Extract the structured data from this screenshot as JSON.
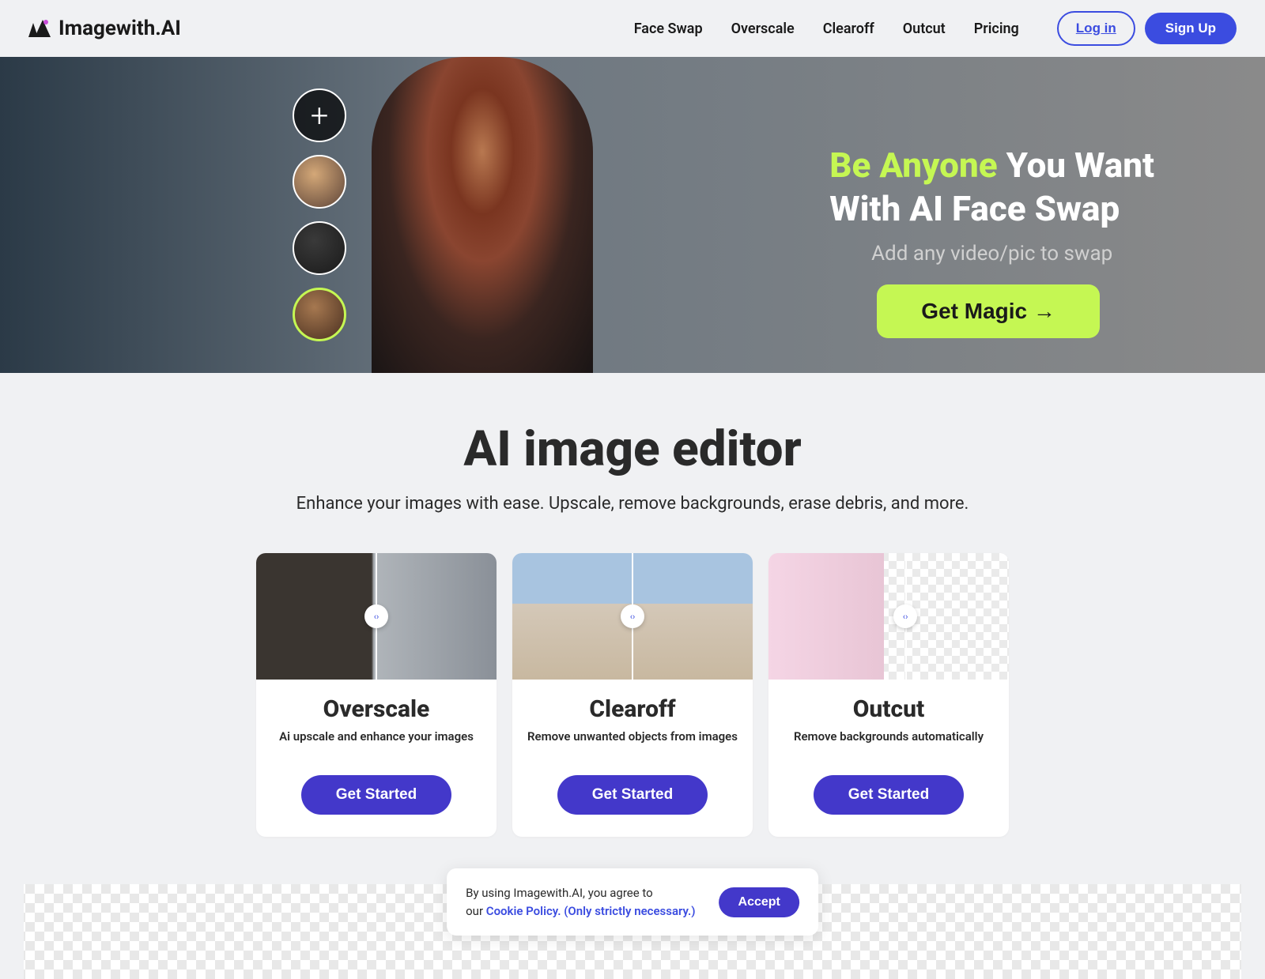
{
  "brand": "Imagewith.AI",
  "nav": {
    "items": [
      "Face Swap",
      "Overscale",
      "Clearoff",
      "Outcut",
      "Pricing"
    ]
  },
  "auth": {
    "login": "Log in",
    "signup": "Sign Up"
  },
  "hero": {
    "title_highlight": "Be Anyone",
    "title_rest1": "You Want",
    "title_rest2": "With AI Face Swap",
    "subtitle": "Add any video/pic to swap",
    "cta": "Get Magic →"
  },
  "main": {
    "title": "AI image editor",
    "subtitle": "Enhance your images with ease. Upscale, remove backgrounds, erase debris, and more."
  },
  "cards": [
    {
      "title": "Overscale",
      "desc": "Ai upscale and enhance your images",
      "btn": "Get Started"
    },
    {
      "title": "Clearoff",
      "desc": "Remove unwanted objects from images",
      "btn": "Get Started"
    },
    {
      "title": "Outcut",
      "desc": "Remove backgrounds automatically",
      "btn": "Get Started"
    }
  ],
  "cookie": {
    "text1": "By using Imagewith.AI, you agree to",
    "text2": "our ",
    "link": "Cookie Policy. (Only strictly necessary.)",
    "accept": "Accept"
  }
}
